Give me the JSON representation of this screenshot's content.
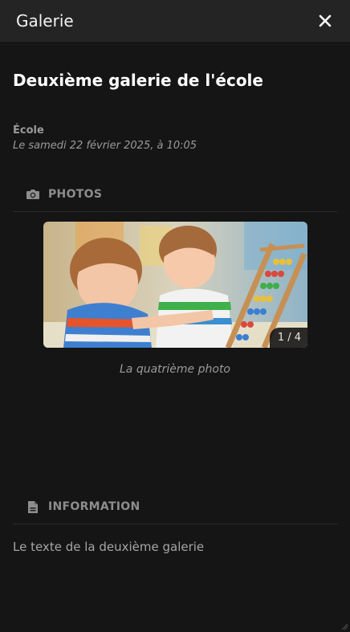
{
  "window": {
    "title": "Galerie"
  },
  "gallery": {
    "title": "Deuxième galerie de l'école",
    "category": "École",
    "date": "Le samedi 22 février 2025, à 10:05"
  },
  "photos": {
    "section_label": "PHOTOS",
    "counter": "1 / 4",
    "caption": "La quatrième photo",
    "current_index": 1,
    "total": 4
  },
  "information": {
    "section_label": "INFORMATION",
    "text": "Le texte de la deuxième galerie"
  },
  "icons": {
    "close": "close-icon",
    "photos": "camera-icon",
    "information": "document-icon"
  },
  "colors": {
    "background": "#151515",
    "titlebar": "#242424",
    "muted_text": "#9a9a9a"
  }
}
